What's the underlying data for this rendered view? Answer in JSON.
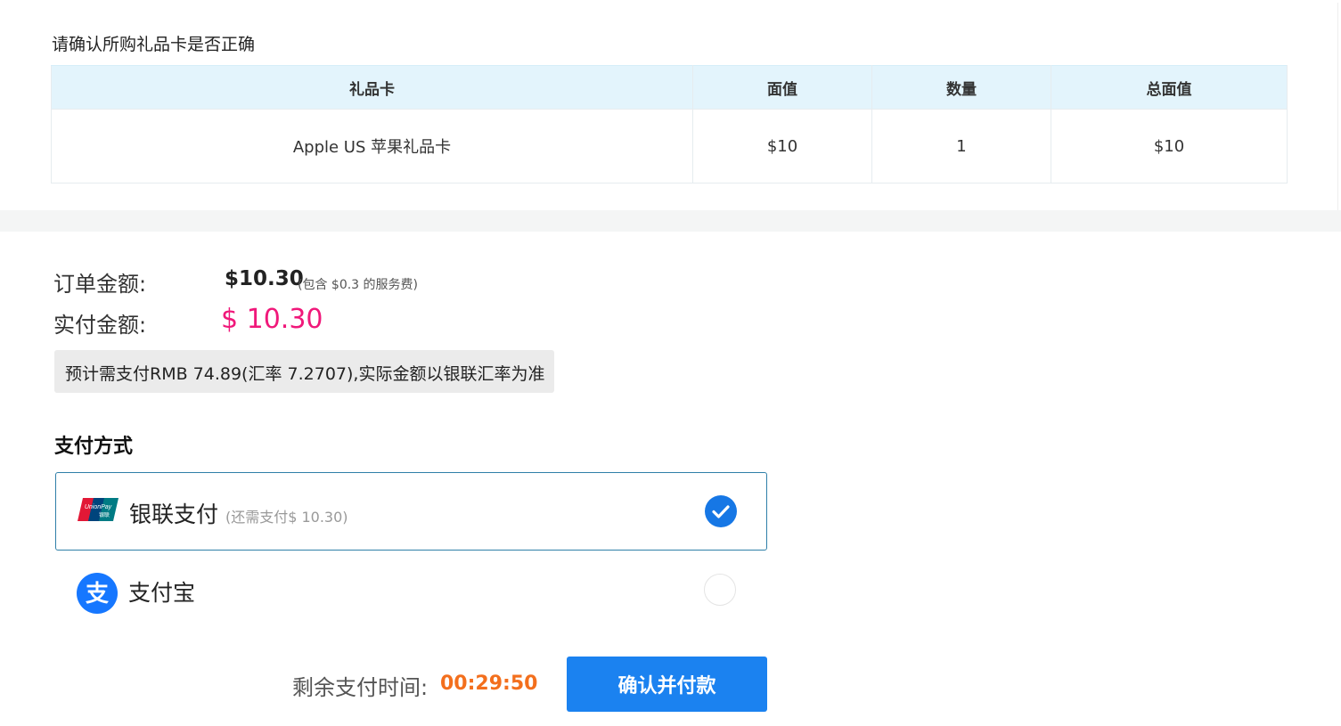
{
  "confirm_title": "请确认所购礼品卡是否正确",
  "table": {
    "headers": [
      "礼品卡",
      "面值",
      "数量",
      "总面值"
    ],
    "rows": [
      [
        "Apple US 苹果礼品卡",
        "$10",
        "1",
        "$10"
      ]
    ]
  },
  "summary": {
    "order_label": "订单金额:",
    "order_amount": "$10.30",
    "fee_note": "(包含 $0.3 的服务费)",
    "pay_label": "实付金额:",
    "pay_amount": "$ 10.30",
    "rmb_note": "预计需支付RMB 74.89(汇率 7.2707),实际金额以银联汇率为准"
  },
  "payment": {
    "title": "支付方式",
    "options": [
      {
        "name": "银联支付",
        "note": "(还需支付$ 10.30)",
        "selected": true,
        "icon": "unionpay-icon"
      },
      {
        "name": "支付宝",
        "note": "",
        "selected": false,
        "icon": "alipay-icon"
      }
    ]
  },
  "footer": {
    "timer_label": "剩余支付时间:",
    "timer_value": "00:29:50",
    "pay_button": "确认并付款"
  },
  "colors": {
    "accent_blue": "#1b82f0",
    "pay_amount_pink": "#f0187a",
    "timer_orange": "#f36f1d",
    "table_header_bg": "#e3f4fc"
  }
}
